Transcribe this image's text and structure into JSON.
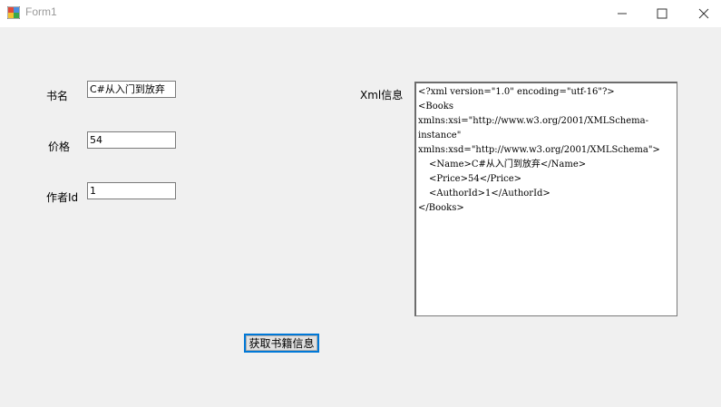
{
  "window": {
    "title": "Form1",
    "minimize_icon": "minimize-icon",
    "maximize_icon": "maximize-icon",
    "close_icon": "close-icon"
  },
  "form": {
    "book_name": {
      "label": "书名",
      "value": "C#从入门到放弃"
    },
    "price": {
      "label": "价格",
      "value": "54"
    },
    "author_id": {
      "label": "作者Id",
      "value": "1"
    },
    "xml_label": "Xml信息",
    "xml_lines": [
      "<?xml version=\"1.0\" encoding=\"utf-16\"?>",
      "<Books",
      "xmlns:xsi=\"http://www.w3.org/2001/XMLSchema-",
      "instance\"",
      "xmlns:xsd=\"http://www.w3.org/2001/XMLSchema\">",
      "  <Name>C#从入门到放弃</Name>",
      "  <Price>54</Price>",
      "  <AuthorId>1</AuthorId>",
      "</Books>"
    ],
    "get_button": "获取书籍信息"
  },
  "colors": {
    "titlebar_bg": "#ffffff",
    "window_bg": "#f0f0f0",
    "button_focus_border": "#0078d7"
  }
}
